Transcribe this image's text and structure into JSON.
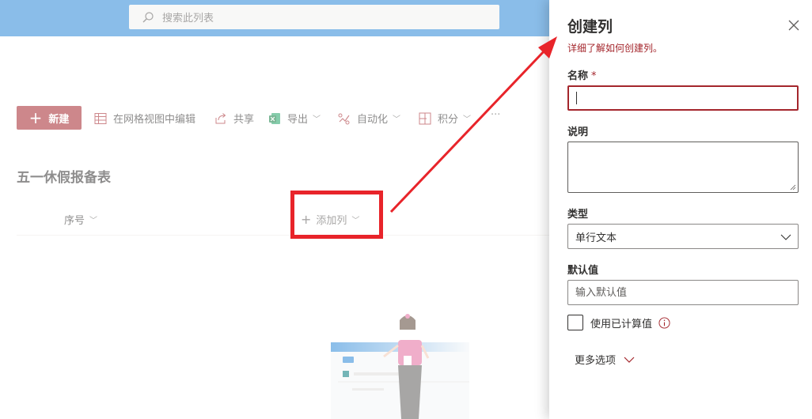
{
  "search": {
    "placeholder": "搜索此列表"
  },
  "commandbar": {
    "new_label": "新建",
    "grid_edit_label": "在网格视图中编辑",
    "share_label": "共享",
    "export_label": "导出",
    "automate_label": "自动化",
    "integrate_label": "积分",
    "more_label": "···"
  },
  "list": {
    "title": "五一休假报备表",
    "columns": [
      {
        "label": "序号"
      },
      {
        "label": "添加列"
      }
    ]
  },
  "panel": {
    "title": "创建列",
    "learn_link": "详细了解如何创建列。",
    "name_label": "名称",
    "required_mark": "*",
    "name_value": "",
    "description_label": "说明",
    "description_value": "",
    "type_label": "类型",
    "type_value": "单行文本",
    "default_label": "默认值",
    "default_placeholder": "输入默认值",
    "calc_label": "使用已计算值",
    "calc_checked": false,
    "more_options_label": "更多选项"
  },
  "colors": {
    "topbar": "#2b88d8",
    "accent": "#a4262c",
    "annotation_red": "#e8242a"
  }
}
